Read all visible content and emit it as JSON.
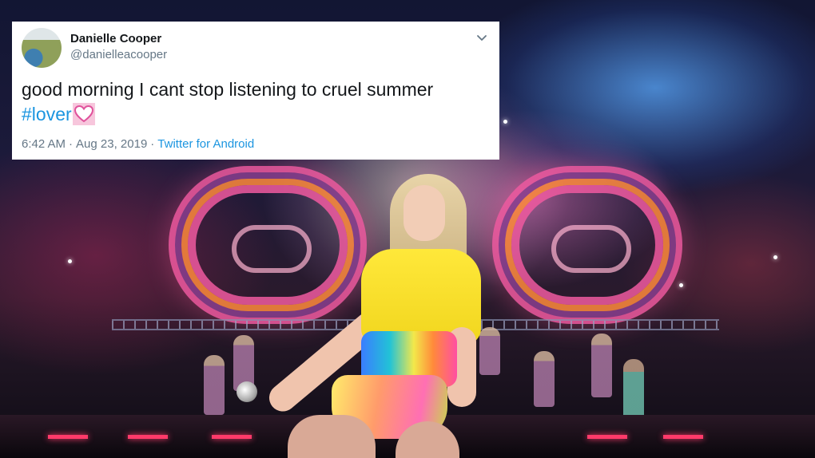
{
  "tweet": {
    "display_name": "Danielle Cooper",
    "handle": "@danielleacooper",
    "text": "good morning I cant stop listening to cruel summer",
    "hashtag": "#lover",
    "emoji": "heart-emoji",
    "time": "6:42 AM",
    "separator": "·",
    "date": "Aug 23, 2019",
    "source": "Twitter for Android",
    "chevron_icon": "chevron-down-icon",
    "colors": {
      "link": "#1b95e0",
      "name": "#14171a",
      "secondary": "#657786",
      "heart": "#e0529c"
    }
  },
  "background": {
    "description_icon": "concert-stage-photo"
  }
}
